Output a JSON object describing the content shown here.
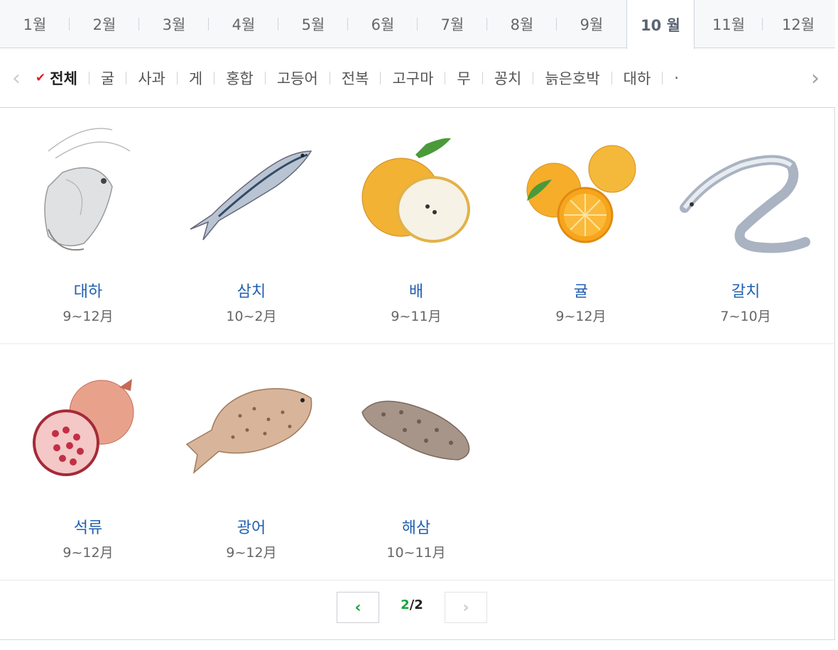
{
  "months": [
    "1월",
    "2월",
    "3월",
    "4월",
    "5월",
    "6월",
    "7월",
    "8월",
    "9월",
    "10 월",
    "11월",
    "12월"
  ],
  "active_month_index": 9,
  "categories": {
    "prev_icon": "chevron-left-icon",
    "next_icon": "chevron-right-icon",
    "check_icon": "check-icon",
    "items": [
      "전체",
      "굴",
      "사과",
      "게",
      "홍합",
      "고등어",
      "전복",
      "고구마",
      "무",
      "꽁치",
      "늙은호박",
      "대하",
      "·"
    ],
    "active_index": 0
  },
  "products": [
    {
      "name": "대하",
      "season": "9~12月",
      "icon": "shrimp-icon"
    },
    {
      "name": "삼치",
      "season": "10~2月",
      "icon": "spanish-mackerel-icon"
    },
    {
      "name": "배",
      "season": "9~11月",
      "icon": "pear-icon"
    },
    {
      "name": "귤",
      "season": "9~12月",
      "icon": "tangerine-icon"
    },
    {
      "name": "갈치",
      "season": "7~10月",
      "icon": "hairtail-icon"
    },
    {
      "name": "석류",
      "season": "9~12月",
      "icon": "pomegranate-icon"
    },
    {
      "name": "광어",
      "season": "9~12月",
      "icon": "flatfish-icon"
    },
    {
      "name": "해삼",
      "season": "10~11月",
      "icon": "sea-cucumber-icon"
    }
  ],
  "pager": {
    "current": "2",
    "separator": "/",
    "total": "2",
    "prev_symbol": "‹",
    "next_symbol": "›"
  },
  "colors": {
    "accent": "#1aa33a",
    "name": "#1f5fb0",
    "check": "#e0202a"
  }
}
